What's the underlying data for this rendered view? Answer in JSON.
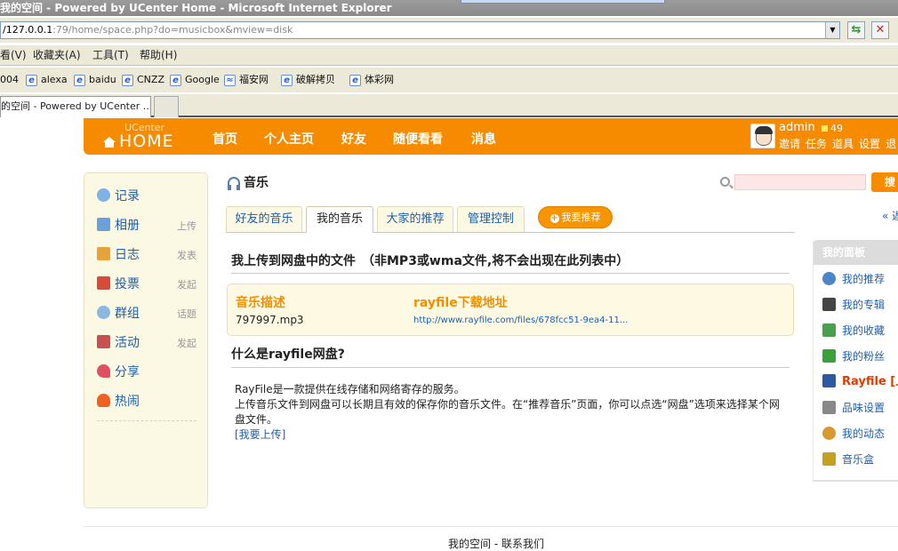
{
  "browser": {
    "title": "我的空间 - Powered by UCenter Home - Microsoft Internet Explorer",
    "address_prefix": "/127.0.0.1",
    "address_rest": ":79/home/space.php?do=musicbox&mview=disk",
    "menu": [
      "看(V)",
      "收藏夹(A)",
      "工具(T)",
      "帮助(H)"
    ],
    "links": [
      {
        "label": "004",
        "icon": false
      },
      {
        "label": "alexa",
        "icon": true
      },
      {
        "label": "baidu",
        "icon": true
      },
      {
        "label": "CNZZ",
        "icon": true
      },
      {
        "label": "Google",
        "icon": true
      },
      {
        "label": "福安网",
        "icon": true
      },
      {
        "label": "破解拷贝",
        "icon": true
      },
      {
        "label": "体彩网",
        "icon": true
      }
    ],
    "tab_label": "的空间 - Powered by UCenter ..."
  },
  "header": {
    "logo_top": "UCenter",
    "logo": "HOME",
    "nav": [
      "首页",
      "个人主页",
      "好友",
      "随便看看",
      "消息"
    ],
    "username": "admin",
    "credits": "49",
    "user_links": [
      "邀请",
      "任务",
      "道具",
      "设置",
      "退"
    ]
  },
  "sidebar": {
    "items": [
      {
        "label": "记录",
        "sub": "",
        "icon": "chat-bubble-icon",
        "color": "#7fb2e5"
      },
      {
        "label": "相册",
        "sub": "上传",
        "icon": "photo-icon",
        "color": "#6aa1d8"
      },
      {
        "label": "日志",
        "sub": "发表",
        "icon": "notebook-icon",
        "color": "#e8a23a"
      },
      {
        "label": "投票",
        "sub": "发起",
        "icon": "bar-chart-icon",
        "color": "#d84a3a"
      },
      {
        "label": "群组",
        "sub": "话题",
        "icon": "group-icon",
        "color": "#8bb8e0"
      },
      {
        "label": "活动",
        "sub": "发起",
        "icon": "calendar-icon",
        "color": "#c85050"
      },
      {
        "label": "分享",
        "sub": "",
        "icon": "heart-icon",
        "color": "#e05060"
      },
      {
        "label": "热闹",
        "sub": "",
        "icon": "fire-icon",
        "color": "#f06020"
      }
    ]
  },
  "main": {
    "title": "音乐",
    "search_button": "搜",
    "tabs": [
      "好友的音乐",
      "我的音乐",
      "大家的推荐",
      "管理控制"
    ],
    "recommend_button": "我要推荐",
    "back_link": "« 返",
    "section1": "我上传到网盘中的文件　（非MP3或wma文件,将不会出现在此列表中）",
    "file": {
      "col1_head": "音乐描述",
      "col2_head": "rayfile下载地址",
      "name": "797997.mp3",
      "url": "http://www.rayfile.com/files/678fcc51-9ea4-11..."
    },
    "section2": "什么是rayfile网盘?",
    "desc_line1": "RayFile是一款提供在线存储和网络寄存的服务。",
    "desc_line2": "上传音乐文件到网盘可以长期且有效的保存你的音乐文件。在“推荐音乐”页面，你可以点选“网盘”选项来选择某个网盘文件。",
    "upload_link": "[我要上传]"
  },
  "right_panel": {
    "title": "我的面板",
    "items": [
      {
        "label": "我的推荐",
        "icon": "music-note-icon",
        "color": "#4a86c8"
      },
      {
        "label": "我的专辑",
        "icon": "cd-icon",
        "color": "#444444"
      },
      {
        "label": "我的收藏",
        "icon": "favorite-add-icon",
        "color": "#4aa04a"
      },
      {
        "label": "我的粉丝",
        "icon": "puzzle-icon",
        "color": "#3aa03a"
      },
      {
        "label": "Rayfile [上",
        "icon": "disk-icon",
        "color": "#2a5aa0"
      },
      {
        "label": "品味设置",
        "icon": "wrench-icon",
        "color": "#888888"
      },
      {
        "label": "我的动态",
        "icon": "clock-icon",
        "color": "#d89a30"
      },
      {
        "label": "音乐盒",
        "icon": "musicbox-icon",
        "color": "#c8a020"
      }
    ]
  },
  "footer": {
    "text": "我的空间 - 联系我们"
  }
}
